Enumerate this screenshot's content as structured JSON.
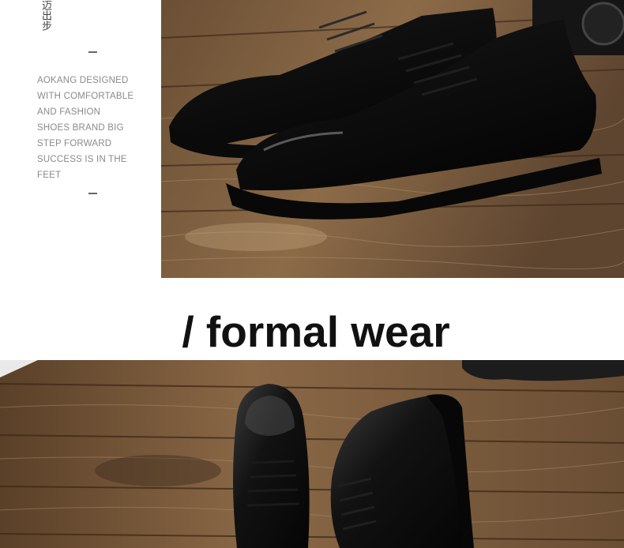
{
  "side_panel": {
    "vertical_label": "迈出步",
    "description_lines": [
      "AOKANG DESIGNED",
      "WITH COMFORTABLE",
      "AND FASHION",
      "SHOES BRAND BIG",
      "STEP FORWARD",
      "SUCCESS IS IN THE",
      "FEET"
    ]
  },
  "heading": {
    "text": "/ formal wear"
  },
  "colors": {
    "wood_light": "#9c7a55",
    "wood_dark": "#4a3422",
    "leather": "#0d0d0d",
    "text_gray": "#8a8a8a"
  }
}
